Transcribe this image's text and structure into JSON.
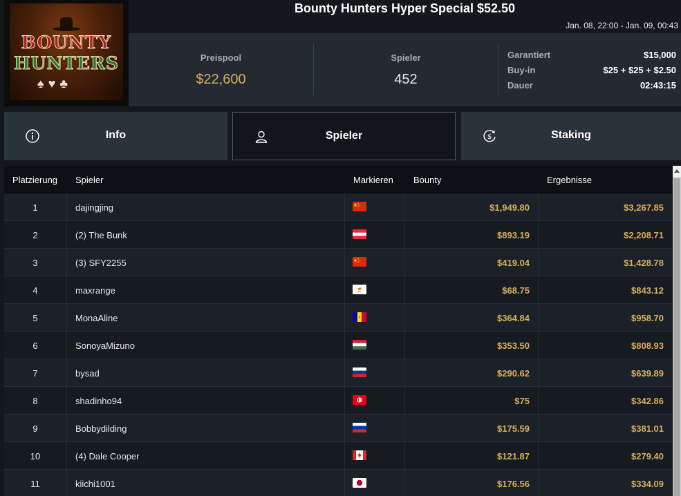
{
  "header": {
    "title": "Bounty Hunters Hyper Special $52.50",
    "date_range": "Jan. 08, 22:00 - Jan. 09, 00:43",
    "logo_text_top": "BOUNTY",
    "logo_text_bottom": "HUNTERS"
  },
  "stats": {
    "prize_pool_label": "Preispool",
    "prize_pool_value": "$22,600",
    "players_label": "Spieler",
    "players_value": "452",
    "details": [
      {
        "label": "Garantiert",
        "value": "$15,000"
      },
      {
        "label": "Buy-in",
        "value": "$25 + $25 + $2.50"
      },
      {
        "label": "Dauer",
        "value": "02:43:15"
      }
    ]
  },
  "tabs": [
    {
      "label": "Info",
      "icon": "info-icon",
      "active": false
    },
    {
      "label": "Spieler",
      "icon": "user-icon",
      "active": true
    },
    {
      "label": "Staking",
      "icon": "dollar-cycle-icon",
      "active": false
    }
  ],
  "table": {
    "headers": {
      "place": "Platzierung",
      "player": "Spieler",
      "flag": "Markieren",
      "bounty": "Bounty",
      "results": "Ergebnisse"
    },
    "rows": [
      {
        "place": "1",
        "player": "dajingjing",
        "flag": "cn",
        "bounty": "$1,949.80",
        "result": "$3,267.85"
      },
      {
        "place": "2",
        "player": "(2) The Bunk",
        "flag": "at",
        "bounty": "$893.19",
        "result": "$2,208.71"
      },
      {
        "place": "3",
        "player": "(3) SFY2255",
        "flag": "cn",
        "bounty": "$419.04",
        "result": "$1,428.78"
      },
      {
        "place": "4",
        "player": "maxrange",
        "flag": "cy",
        "bounty": "$68.75",
        "result": "$843.12"
      },
      {
        "place": "5",
        "player": "MonaAline",
        "flag": "ad",
        "bounty": "$364.84",
        "result": "$958.70"
      },
      {
        "place": "6",
        "player": "SonoyaMizuno",
        "flag": "hu",
        "bounty": "$353.50",
        "result": "$808.93"
      },
      {
        "place": "7",
        "player": "bysad",
        "flag": "ru",
        "bounty": "$290.62",
        "result": "$639.89"
      },
      {
        "place": "8",
        "player": "shadinho94",
        "flag": "tn",
        "bounty": "$75",
        "result": "$342.86"
      },
      {
        "place": "9",
        "player": "Bobbydilding",
        "flag": "ru",
        "bounty": "$175.59",
        "result": "$381.01"
      },
      {
        "place": "10",
        "player": "(4) Dale Cooper",
        "flag": "ca",
        "bounty": "$121.87",
        "result": "$279.40"
      },
      {
        "place": "11",
        "player": "kiichi1001",
        "flag": "jp",
        "bounty": "$176.56",
        "result": "$334.09"
      }
    ]
  },
  "colors": {
    "accent_gold": "#d9ad5c",
    "bg_dark": "#14181d",
    "panel": "#232a32"
  }
}
